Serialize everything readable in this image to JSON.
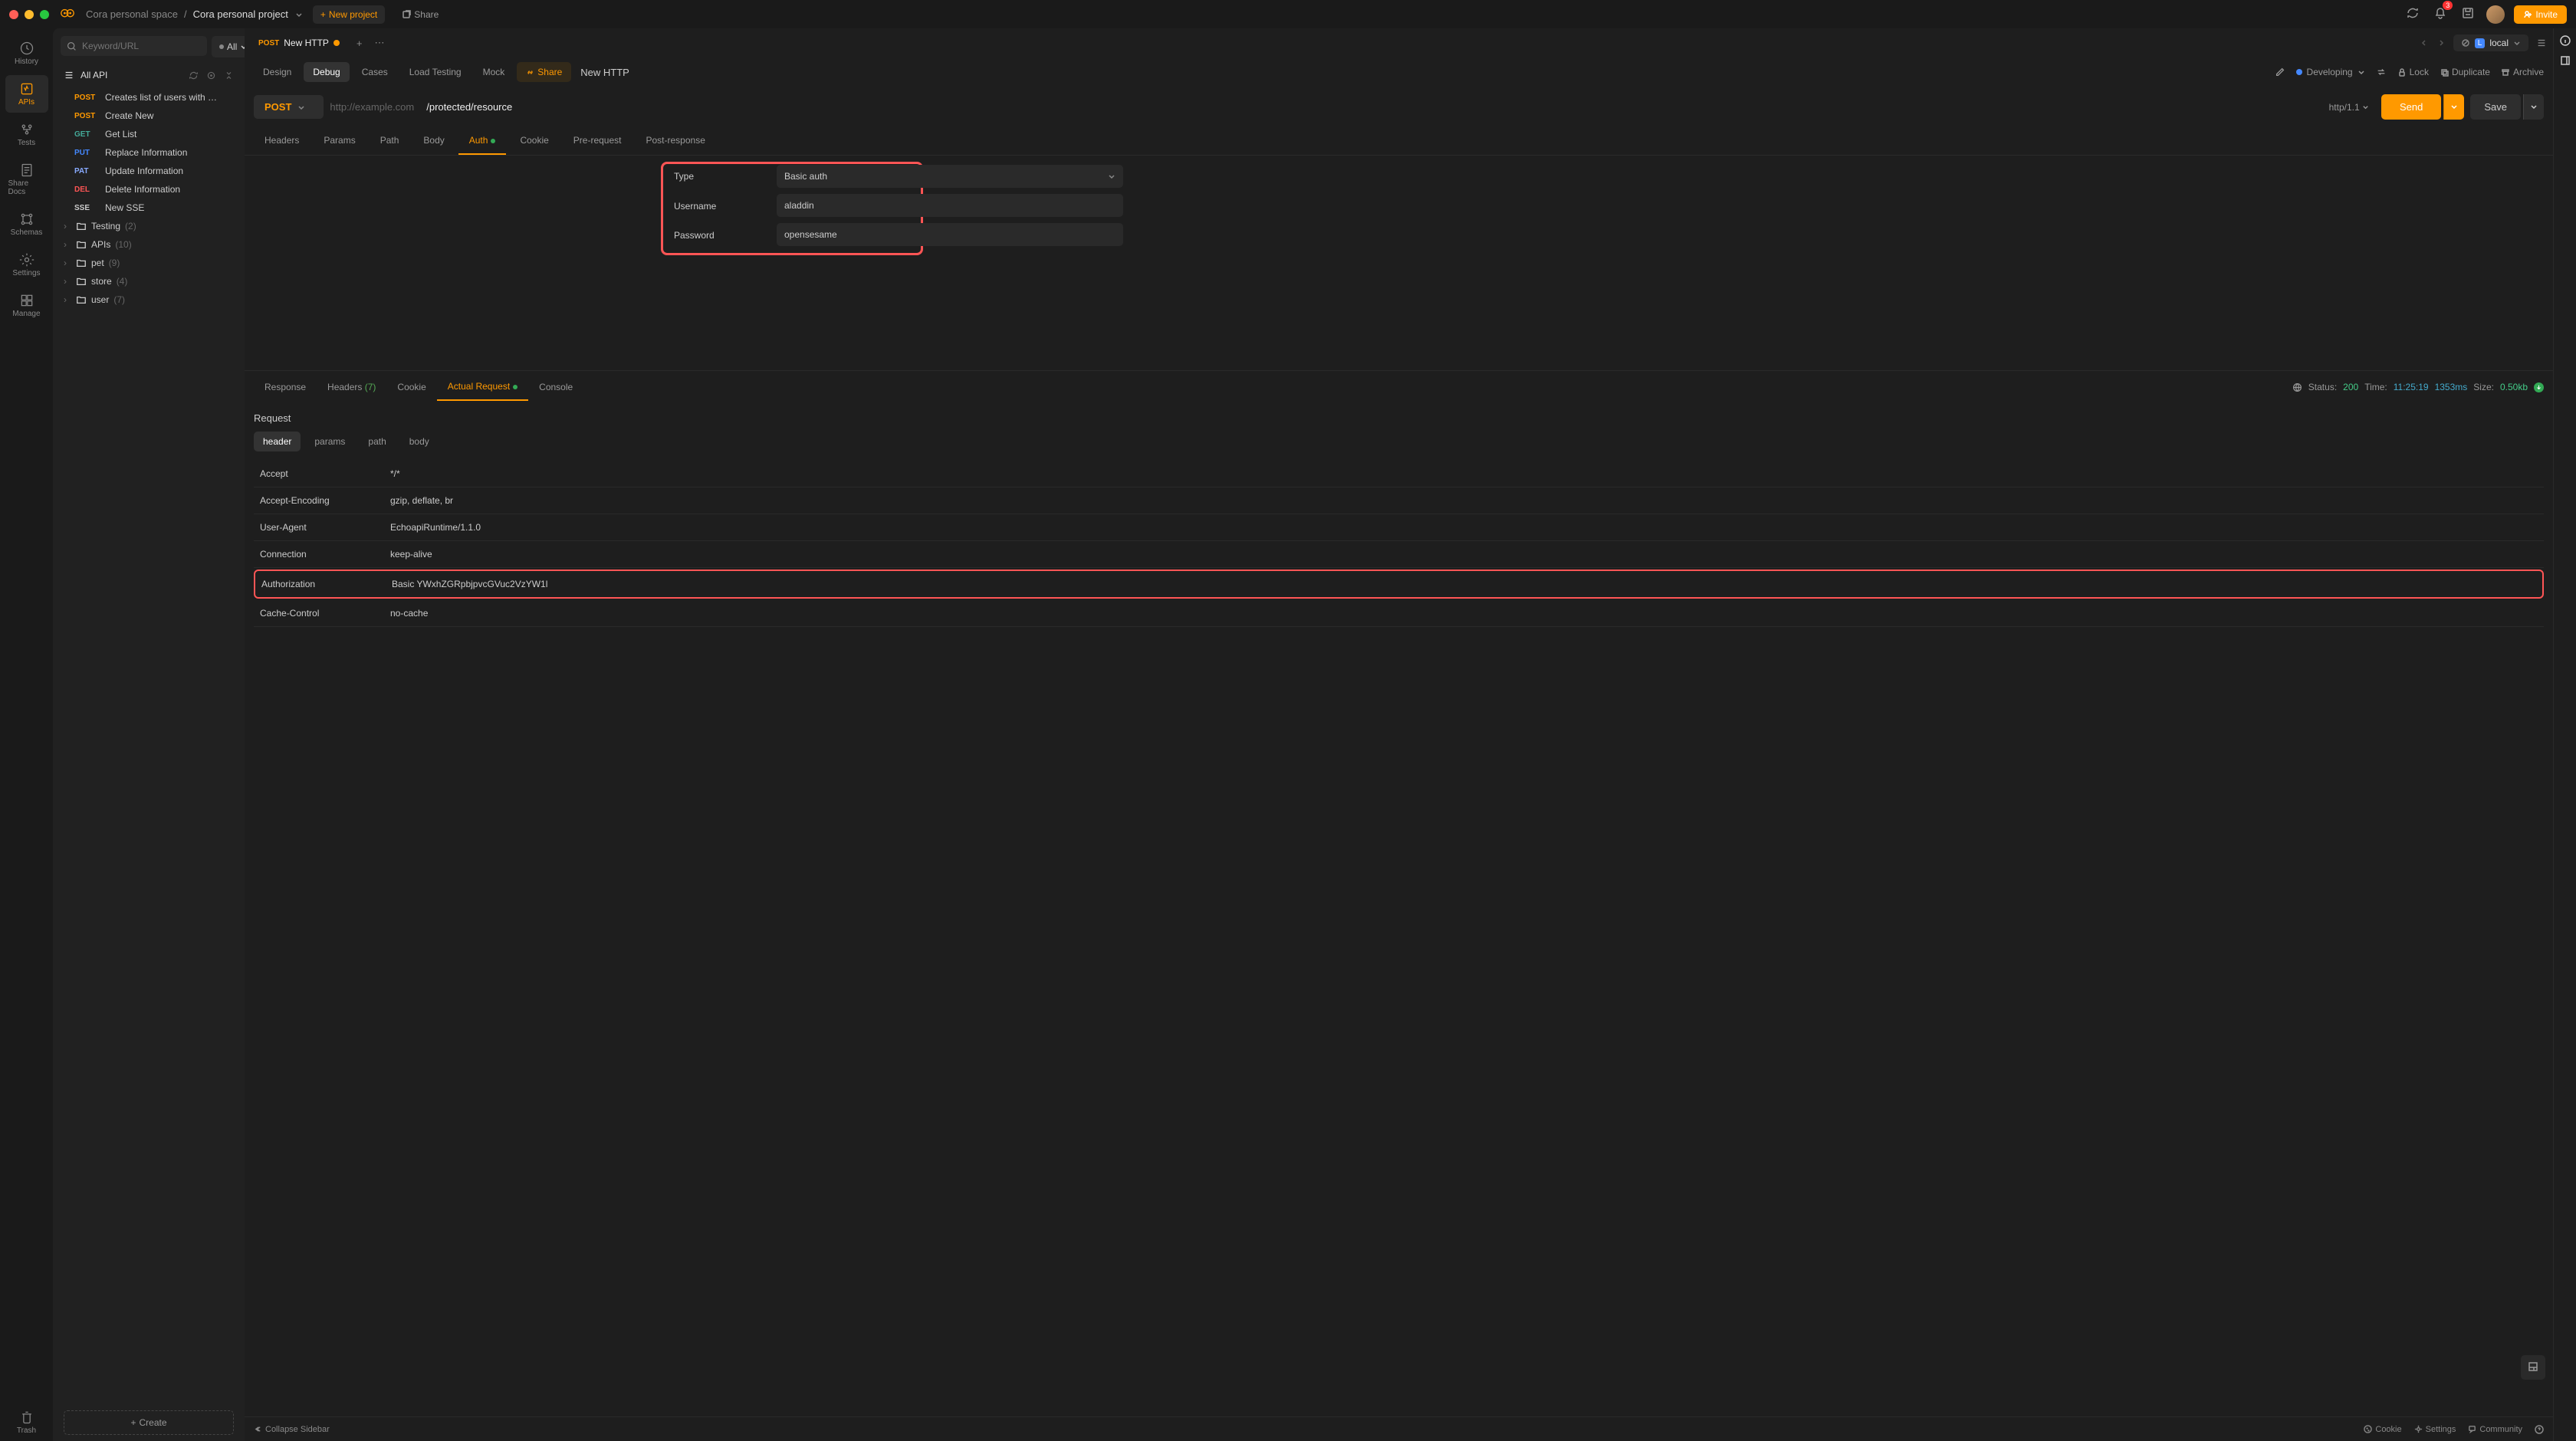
{
  "titlebar": {
    "workspace": "Cora personal space",
    "project": "Cora personal project",
    "new_project": "New project",
    "share": "Share",
    "notif_count": "3",
    "env_label": "local",
    "env_letter": "L",
    "invite": "Invite"
  },
  "nav": {
    "history": "History",
    "apis": "APIs",
    "tests": "Tests",
    "share_docs": "Share Docs",
    "schemas": "Schemas",
    "settings": "Settings",
    "manage": "Manage",
    "trash": "Trash"
  },
  "sidebar": {
    "search_placeholder": "Keyword/URL",
    "filter": "All",
    "all_api": "All API",
    "items": [
      {
        "method": "POST",
        "mclass": "m-post",
        "label": "Creates list of users with …"
      },
      {
        "method": "POST",
        "mclass": "m-post",
        "label": "Create New"
      },
      {
        "method": "GET",
        "mclass": "m-get",
        "label": "Get List"
      },
      {
        "method": "PUT",
        "mclass": "m-put",
        "label": "Replace Information"
      },
      {
        "method": "PAT",
        "mclass": "m-pat",
        "label": "Update Information"
      },
      {
        "method": "DEL",
        "mclass": "m-del",
        "label": "Delete Information"
      },
      {
        "method": "SSE",
        "mclass": "m-sse",
        "label": "New SSE"
      }
    ],
    "folders": [
      {
        "name": "Testing",
        "count": "(2)"
      },
      {
        "name": "APIs",
        "count": "(10)"
      },
      {
        "name": "pet",
        "count": "(9)"
      },
      {
        "name": "store",
        "count": "(4)"
      },
      {
        "name": "user",
        "count": "(7)"
      }
    ],
    "create": "Create"
  },
  "tabs": {
    "current_method": "POST",
    "current_label": "New HTTP"
  },
  "subtabs": {
    "design": "Design",
    "debug": "Debug",
    "cases": "Cases",
    "load": "Load Testing",
    "mock": "Mock",
    "share": "Share",
    "title": "New HTTP",
    "status": "Developing",
    "lock": "Lock",
    "duplicate": "Duplicate",
    "archive": "Archive"
  },
  "request": {
    "method": "POST",
    "placeholder": "http://example.com",
    "path": "/protected/resource",
    "protocol": "http/1.1",
    "send": "Send",
    "save": "Save"
  },
  "reqtabs": {
    "headers": "Headers",
    "params": "Params",
    "path": "Path",
    "body": "Body",
    "auth": "Auth",
    "cookie": "Cookie",
    "pre": "Pre-request",
    "post": "Post-response"
  },
  "auth": {
    "type_label": "Type",
    "type_value": "Basic auth",
    "user_label": "Username",
    "user_value": "aladdin",
    "pass_label": "Password",
    "pass_value": "opensesame"
  },
  "resp": {
    "response": "Response",
    "headers": "Headers",
    "headers_count": "(7)",
    "cookie": "Cookie",
    "actual": "Actual Request",
    "console": "Console",
    "status_label": "Status:",
    "status_val": "200",
    "time_label": "Time:",
    "time_val": "11:25:19",
    "time_ms": "1353ms",
    "size_label": "Size:",
    "size_val": "0.50kb"
  },
  "actual": {
    "title": "Request",
    "header": "header",
    "params": "params",
    "path": "path",
    "body": "body",
    "rows": [
      {
        "k": "Accept",
        "v": "*/*"
      },
      {
        "k": "Accept-Encoding",
        "v": "gzip, deflate, br"
      },
      {
        "k": "User-Agent",
        "v": "EchoapiRuntime/1.1.0"
      },
      {
        "k": "Connection",
        "v": "keep-alive"
      },
      {
        "k": "Authorization",
        "v": "Basic YWxhZGRpbjpvcGVuc2VzYW1l",
        "hl": true
      },
      {
        "k": "Cache-Control",
        "v": "no-cache"
      }
    ]
  },
  "footer": {
    "collapse": "Collapse Sidebar",
    "cookie": "Cookie",
    "settings": "Settings",
    "community": "Community"
  }
}
